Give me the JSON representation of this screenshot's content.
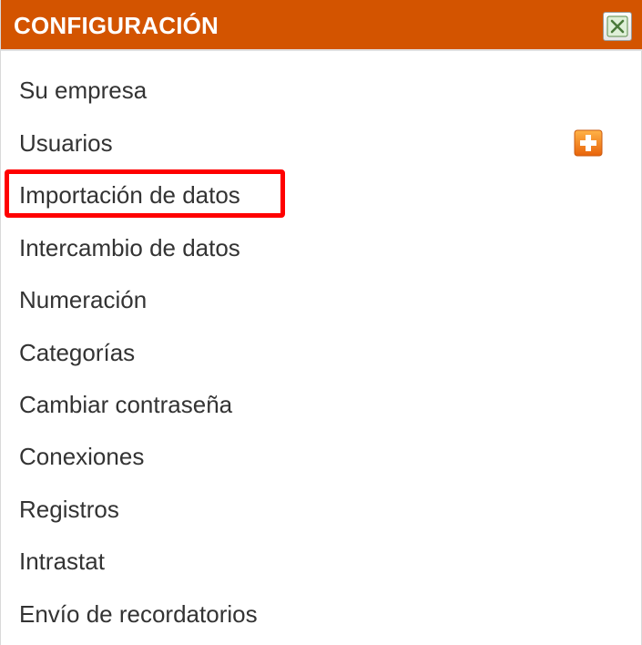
{
  "header": {
    "title": "CONFIGURACIÓN",
    "close_icon": "close-icon",
    "background_color": "#d35400"
  },
  "menu": {
    "items": [
      {
        "label": "Su empresa"
      },
      {
        "label": "Usuarios",
        "action_icon": "add-icon"
      },
      {
        "label": "Importación de datos",
        "highlighted": true
      },
      {
        "label": "Intercambio de datos"
      },
      {
        "label": "Numeración"
      },
      {
        "label": "Categorías"
      },
      {
        "label": "Cambiar contraseña"
      },
      {
        "label": "Conexiones"
      },
      {
        "label": "Registros"
      },
      {
        "label": "Intrastat"
      },
      {
        "label": "Envío de recordatorios"
      }
    ]
  },
  "highlight_color": "#ff0000"
}
